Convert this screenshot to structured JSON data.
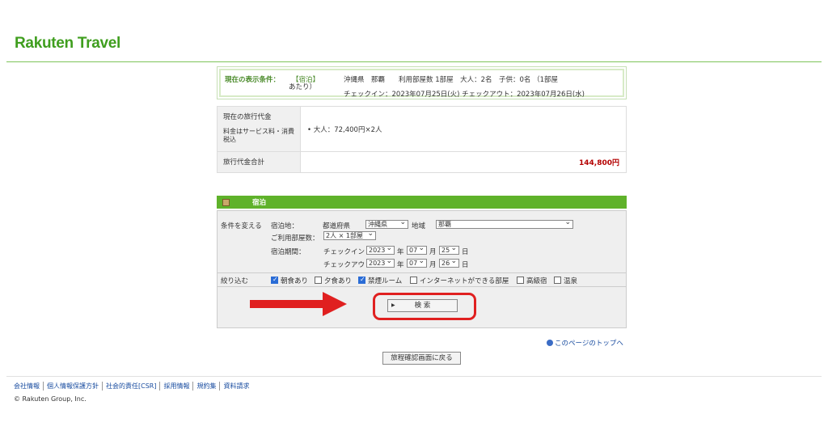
{
  "brand": {
    "logo": "Rakuten Travel",
    "accent": "#3f9e1e"
  },
  "conditions": {
    "label": "現在の表示条件：",
    "stay_type": "【宿泊】",
    "line1": "沖縄県　那覇　　利用部屋数 1部屋　大人：2名　子供：0名 （1部屋",
    "line1b": "あたり）",
    "line2": "チェックイン：2023年07月25日(火)  チェックアウト：2023年07月26日(水)"
  },
  "price": {
    "current_label": "現在の旅行代金",
    "current_note": "料金はサービス料・消費税込",
    "current_value": "• 大人：72,400円×2人",
    "total_label": "旅行代金合計",
    "total_value": "144,800円"
  },
  "stay": {
    "title": "宿泊",
    "change_label": "条件を変える",
    "location_label": "宿泊地：",
    "pref_label": "都道府県",
    "pref_value": "沖縄県",
    "area_label": "地域",
    "area_value": "那覇",
    "rooms_label": "ご利用部屋数：",
    "rooms_value": "2人 × 1部屋",
    "period_label": "宿泊期間：",
    "checkin_label": "チェックイン",
    "checkout_label": "チェックアウト",
    "checkin": {
      "year": "2023",
      "month": "07",
      "day": "25"
    },
    "checkout": {
      "year": "2023",
      "month": "07",
      "day": "26"
    },
    "year_unit": "年",
    "month_unit": "月",
    "day_unit": "日",
    "filter_label": "絞り込む",
    "filters": [
      {
        "label": "朝食あり",
        "checked": true
      },
      {
        "label": "夕食あり",
        "checked": false
      },
      {
        "label": "禁煙ルーム",
        "checked": true
      },
      {
        "label": "インターネットができる部屋",
        "checked": false
      },
      {
        "label": "高級宿",
        "checked": false
      },
      {
        "label": "温泉",
        "checked": false
      }
    ],
    "search_button": "検 索"
  },
  "page_top_link": "このページのトップへ",
  "back_button": "旅程確認画面に戻る",
  "footer": {
    "links": [
      "会社情報",
      "個人情報保護方針",
      "社会的責任[CSR]",
      "採用情報",
      "規約集",
      "資料請求"
    ],
    "copyright": "© Rakuten Group, Inc."
  }
}
